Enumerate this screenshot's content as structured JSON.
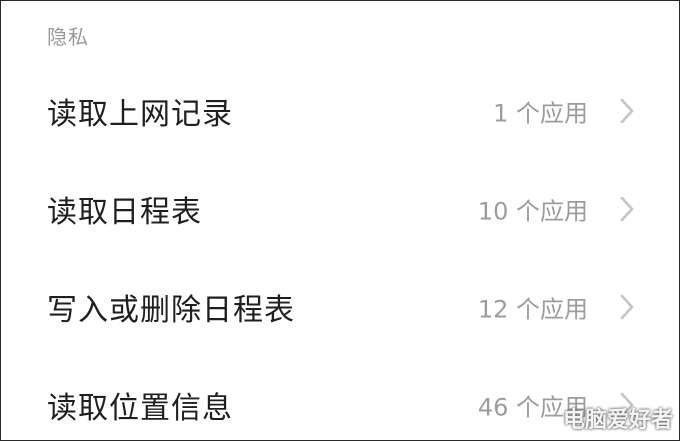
{
  "section": {
    "title": "隐私"
  },
  "items": [
    {
      "label": "读取上网记录",
      "count": "1 个应用"
    },
    {
      "label": "读取日程表",
      "count": "10 个应用"
    },
    {
      "label": "写入或删除日程表",
      "count": "12 个应用"
    },
    {
      "label": "读取位置信息",
      "count": "46 个应用"
    }
  ],
  "icons": {
    "chevron": "chevron-right-icon"
  },
  "colors": {
    "title_text": "#1f1f1f",
    "secondary_text": "#9c9c9c",
    "chevron": "#c4c4c4",
    "background": "#ffffff"
  },
  "watermark": "电脑爱好者"
}
